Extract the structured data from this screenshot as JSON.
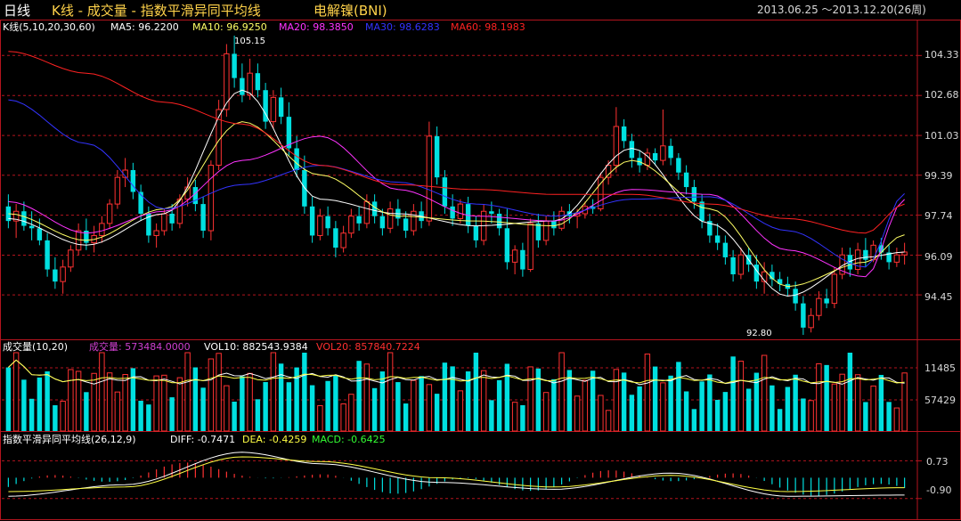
{
  "title": {
    "period": "日线",
    "name": "K线 - 成交量 - 指数平滑异同平均线",
    "security": "电解镍(BNI)",
    "date_range": "2013.06.25 ～2013.12.20(26周)"
  },
  "kline": {
    "legend": "K线(5,10,20,30,60)",
    "ma": [
      {
        "label": "MA5: 96.2200",
        "color": "#ffffff"
      },
      {
        "label": "MA10: 96.9250",
        "color": "#ffff66"
      },
      {
        "label": "MA20: 98.3850",
        "color": "#ff33ff"
      },
      {
        "label": "MA30: 98.6283",
        "color": "#3333ff"
      },
      {
        "label": "MA60: 98.1983",
        "color": "#ff2222"
      }
    ],
    "high_label": "105.15",
    "low_label": "92.80",
    "ticks": [
      "104.33",
      "102.68",
      "101.03",
      "99.39",
      "97.74",
      "96.09",
      "94.45"
    ]
  },
  "volume": {
    "legend": "成交量(10,20)",
    "vol_label": "成交量: 573484.0000",
    "vol10_label": "VOL10: 882543.9384",
    "vol20_label": "VOL20: 857840.7224",
    "ticks": [
      "11485",
      "57429"
    ]
  },
  "macd": {
    "legend": "指数平滑异同平均线(26,12,9)",
    "diff_label": "DIFF: -0.7471",
    "dea_label": "DEA: -0.4259",
    "macd_label": "MACD: -0.6425",
    "ticks": [
      "0.73",
      "-0.90"
    ]
  },
  "colors": {
    "up": "#ff3232",
    "down": "#00e0e0",
    "grid": "#b4141e",
    "text_gold": "#ffd24a",
    "tick_text": "#d8d8d8"
  },
  "chart_data": {
    "type": "candlestick",
    "title": "K线 - 成交量 - 指数平滑异同平均线",
    "ylim": [
      92.8,
      105.15
    ],
    "ohlc": [
      [
        98.1,
        98.6,
        97.2,
        97.5
      ],
      [
        97.5,
        98.2,
        96.8,
        97.9
      ],
      [
        97.9,
        98.3,
        97.1,
        97.3
      ],
      [
        97.3,
        97.9,
        96.7,
        97.2
      ],
      [
        97.2,
        97.6,
        96.5,
        96.7
      ],
      [
        96.7,
        97.0,
        95.2,
        95.5
      ],
      [
        95.5,
        96.0,
        94.7,
        95.0
      ],
      [
        95.0,
        95.9,
        94.5,
        95.6
      ],
      [
        95.6,
        96.5,
        95.4,
        96.3
      ],
      [
        96.3,
        97.4,
        96.1,
        97.1
      ],
      [
        97.1,
        97.6,
        96.3,
        96.6
      ],
      [
        96.6,
        97.3,
        96.2,
        96.9
      ],
      [
        96.9,
        97.7,
        96.6,
        97.4
      ],
      [
        97.4,
        98.4,
        97.2,
        98.2
      ],
      [
        98.2,
        99.6,
        98.0,
        99.3
      ],
      [
        99.3,
        100.1,
        98.9,
        99.6
      ],
      [
        99.6,
        99.9,
        98.4,
        98.7
      ],
      [
        98.7,
        99.0,
        97.5,
        97.8
      ],
      [
        97.8,
        98.1,
        96.6,
        96.9
      ],
      [
        96.9,
        97.4,
        96.4,
        97.1
      ],
      [
        97.1,
        98.0,
        96.9,
        97.8
      ],
      [
        97.8,
        98.2,
        97.1,
        97.4
      ],
      [
        97.4,
        98.6,
        97.2,
        98.4
      ],
      [
        98.4,
        99.3,
        98.1,
        98.9
      ],
      [
        98.9,
        99.2,
        97.9,
        98.2
      ],
      [
        98.2,
        98.5,
        96.8,
        97.1
      ],
      [
        97.1,
        100.0,
        96.7,
        99.8
      ],
      [
        99.8,
        102.5,
        99.6,
        102.1
      ],
      [
        102.1,
        104.8,
        101.8,
        104.4
      ],
      [
        104.4,
        105.15,
        103.0,
        103.4
      ],
      [
        103.4,
        104.0,
        102.4,
        102.7
      ],
      [
        102.7,
        104.2,
        102.5,
        103.6
      ],
      [
        103.6,
        104.0,
        102.6,
        102.9
      ],
      [
        102.9,
        103.2,
        101.3,
        101.6
      ],
      [
        101.6,
        102.9,
        101.3,
        102.6
      ],
      [
        102.6,
        103.0,
        101.5,
        101.8
      ],
      [
        101.8,
        102.4,
        100.2,
        100.5
      ],
      [
        100.5,
        101.0,
        99.3,
        99.6
      ],
      [
        99.6,
        100.2,
        97.8,
        98.1
      ],
      [
        98.1,
        98.5,
        96.6,
        96.9
      ],
      [
        96.9,
        98.0,
        96.7,
        97.7
      ],
      [
        97.7,
        98.1,
        96.9,
        97.2
      ],
      [
        97.2,
        97.5,
        96.0,
        96.4
      ],
      [
        96.4,
        97.3,
        96.2,
        97.0
      ],
      [
        97.0,
        98.0,
        96.8,
        97.7
      ],
      [
        97.7,
        98.1,
        97.1,
        97.4
      ],
      [
        97.4,
        98.6,
        97.2,
        98.3
      ],
      [
        98.3,
        98.6,
        97.4,
        97.7
      ],
      [
        97.7,
        98.0,
        96.9,
        97.2
      ],
      [
        97.2,
        98.3,
        97.0,
        98.0
      ],
      [
        98.0,
        98.4,
        97.3,
        97.6
      ],
      [
        97.6,
        97.9,
        96.8,
        97.1
      ],
      [
        97.1,
        98.2,
        96.9,
        97.9
      ],
      [
        97.9,
        98.3,
        97.2,
        97.5
      ],
      [
        97.5,
        101.6,
        97.3,
        101.0
      ],
      [
        101.0,
        101.4,
        99.0,
        99.3
      ],
      [
        99.3,
        99.6,
        97.8,
        98.1
      ],
      [
        98.1,
        98.6,
        97.3,
        97.6
      ],
      [
        97.6,
        98.4,
        97.4,
        98.2
      ],
      [
        98.2,
        98.5,
        97.0,
        97.3
      ],
      [
        97.3,
        97.7,
        96.4,
        96.7
      ],
      [
        96.7,
        98.2,
        96.5,
        97.9
      ],
      [
        97.9,
        98.3,
        97.4,
        97.8
      ],
      [
        97.8,
        98.0,
        96.9,
        97.2
      ],
      [
        97.2,
        98.0,
        95.5,
        95.8
      ],
      [
        95.8,
        96.5,
        95.3,
        96.3
      ],
      [
        96.3,
        96.6,
        95.2,
        95.5
      ],
      [
        95.5,
        97.6,
        95.4,
        97.4
      ],
      [
        97.4,
        97.8,
        96.4,
        96.7
      ],
      [
        96.7,
        97.7,
        96.5,
        97.5
      ],
      [
        97.5,
        97.9,
        96.9,
        97.2
      ],
      [
        97.2,
        98.1,
        97.1,
        97.9
      ],
      [
        97.9,
        98.2,
        97.4,
        97.7
      ],
      [
        97.7,
        98.0,
        97.2,
        97.8
      ],
      [
        97.8,
        98.3,
        97.6,
        98.1
      ],
      [
        98.1,
        98.4,
        97.8,
        98.0
      ],
      [
        98.0,
        99.5,
        97.9,
        99.3
      ],
      [
        99.3,
        100.0,
        99.0,
        99.8
      ],
      [
        99.8,
        102.2,
        99.5,
        101.4
      ],
      [
        101.4,
        101.7,
        100.5,
        100.8
      ],
      [
        100.8,
        101.1,
        99.7,
        100.1
      ],
      [
        100.1,
        100.4,
        99.5,
        99.8
      ],
      [
        99.8,
        100.5,
        99.6,
        100.3
      ],
      [
        100.3,
        100.5,
        99.8,
        100.0
      ],
      [
        100.0,
        102.1,
        99.8,
        100.6
      ],
      [
        100.6,
        100.9,
        99.8,
        100.1
      ],
      [
        100.1,
        100.3,
        99.2,
        99.5
      ],
      [
        99.5,
        99.8,
        98.6,
        98.9
      ],
      [
        98.9,
        99.2,
        98.0,
        98.3
      ],
      [
        98.3,
        98.6,
        97.2,
        97.5
      ],
      [
        97.5,
        97.8,
        96.6,
        96.9
      ],
      [
        96.9,
        97.4,
        96.3,
        96.6
      ],
      [
        96.6,
        96.9,
        95.7,
        96.0
      ],
      [
        96.0,
        96.3,
        95.0,
        95.3
      ],
      [
        95.3,
        96.4,
        95.1,
        96.1
      ],
      [
        96.1,
        96.4,
        95.4,
        95.7
      ],
      [
        95.7,
        96.1,
        94.7,
        95.0
      ],
      [
        95.0,
        95.8,
        94.5,
        95.4
      ],
      [
        95.4,
        95.7,
        94.8,
        95.1
      ],
      [
        95.1,
        95.4,
        94.6,
        94.9
      ],
      [
        94.9,
        95.2,
        94.4,
        94.7
      ],
      [
        94.7,
        95.0,
        93.8,
        94.1
      ],
      [
        94.1,
        94.4,
        92.8,
        93.1
      ],
      [
        93.1,
        93.9,
        92.9,
        93.6
      ],
      [
        93.6,
        94.6,
        93.4,
        94.3
      ],
      [
        94.3,
        94.7,
        93.9,
        94.1
      ],
      [
        94.1,
        95.6,
        93.9,
        95.3
      ],
      [
        95.3,
        96.4,
        95.1,
        96.1
      ],
      [
        96.1,
        96.4,
        95.2,
        95.5
      ],
      [
        95.5,
        96.6,
        95.3,
        96.3
      ],
      [
        96.3,
        96.8,
        95.6,
        95.9
      ],
      [
        95.9,
        96.7,
        95.8,
        96.5
      ],
      [
        96.5,
        96.8,
        95.9,
        96.2
      ],
      [
        96.2,
        96.5,
        95.5,
        95.8
      ],
      [
        95.8,
        96.4,
        95.6,
        96.1
      ],
      [
        96.1,
        96.6,
        95.7,
        96.22
      ]
    ],
    "ma_series": [
      {
        "name": "MA5",
        "anchors": [
          [
            0,
            97.6
          ],
          [
            10,
            96.5
          ],
          [
            20,
            97.8
          ],
          [
            30,
            102.9
          ],
          [
            40,
            98.4
          ],
          [
            50,
            97.8
          ],
          [
            60,
            97.3
          ],
          [
            70,
            97.5
          ],
          [
            80,
            100.5
          ],
          [
            90,
            97.4
          ],
          [
            100,
            94.4
          ],
          [
            110,
            96.0
          ],
          [
            115,
            96.22
          ]
        ]
      },
      {
        "name": "MA10",
        "anchors": [
          [
            0,
            97.8
          ],
          [
            10,
            96.7
          ],
          [
            20,
            98.0
          ],
          [
            30,
            101.6
          ],
          [
            40,
            99.4
          ],
          [
            50,
            97.7
          ],
          [
            60,
            97.5
          ],
          [
            70,
            97.3
          ],
          [
            80,
            100.0
          ],
          [
            90,
            98.0
          ],
          [
            100,
            94.8
          ],
          [
            110,
            95.8
          ],
          [
            115,
            96.93
          ]
        ]
      },
      {
        "name": "MA20",
        "anchors": [
          [
            0,
            98.3
          ],
          [
            10,
            97.0
          ],
          [
            20,
            97.9
          ],
          [
            30,
            100.0
          ],
          [
            40,
            101.0
          ],
          [
            50,
            98.8
          ],
          [
            60,
            97.7
          ],
          [
            70,
            97.5
          ],
          [
            80,
            98.8
          ],
          [
            90,
            98.6
          ],
          [
            100,
            96.3
          ],
          [
            110,
            95.2
          ],
          [
            115,
            98.39
          ]
        ]
      },
      {
        "name": "MA30",
        "anchors": [
          [
            0,
            102.5
          ],
          [
            10,
            100.7
          ],
          [
            20,
            98.0
          ],
          [
            30,
            99.0
          ],
          [
            40,
            99.8
          ],
          [
            50,
            99.1
          ],
          [
            60,
            98.2
          ],
          [
            70,
            97.7
          ],
          [
            80,
            98.4
          ],
          [
            90,
            98.5
          ],
          [
            100,
            97.1
          ],
          [
            110,
            95.6
          ],
          [
            115,
            98.63
          ]
        ]
      },
      {
        "name": "MA60",
        "anchors": [
          [
            0,
            104.5
          ],
          [
            10,
            103.6
          ],
          [
            20,
            102.4
          ],
          [
            30,
            101.5
          ],
          [
            40,
            99.8
          ],
          [
            50,
            99.0
          ],
          [
            60,
            98.8
          ],
          [
            70,
            98.6
          ],
          [
            80,
            98.6
          ],
          [
            90,
            98.2
          ],
          [
            100,
            97.6
          ],
          [
            110,
            97.0
          ],
          [
            115,
            98.2
          ]
        ]
      }
    ],
    "macd_series": [
      {
        "name": "DIFF",
        "anchors": [
          [
            0,
            -0.8
          ],
          [
            15,
            -0.3
          ],
          [
            30,
            1.1
          ],
          [
            40,
            0.6
          ],
          [
            55,
            -0.2
          ],
          [
            70,
            -0.5
          ],
          [
            85,
            0.2
          ],
          [
            100,
            -0.8
          ],
          [
            115,
            -0.75
          ]
        ]
      },
      {
        "name": "DEA",
        "anchors": [
          [
            0,
            -0.6
          ],
          [
            15,
            -0.4
          ],
          [
            30,
            0.9
          ],
          [
            40,
            0.7
          ],
          [
            55,
            0.0
          ],
          [
            70,
            -0.4
          ],
          [
            85,
            0.1
          ],
          [
            100,
            -0.6
          ],
          [
            115,
            -0.43
          ]
        ]
      }
    ]
  }
}
